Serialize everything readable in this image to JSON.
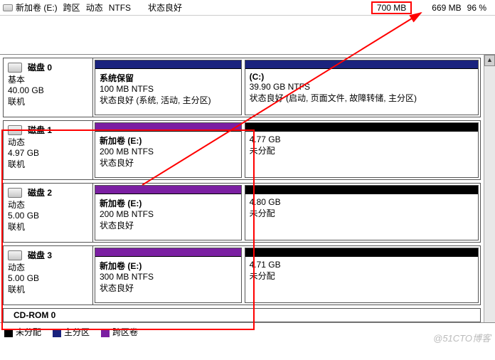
{
  "top": {
    "name": "新加卷 (E:)",
    "layout": "跨区",
    "type": "动态",
    "fs": "NTFS",
    "status": "状态良好",
    "size": "700 MB",
    "free": "669 MB",
    "percent": "96 %"
  },
  "disks": [
    {
      "title": "磁盘 0",
      "kind": "基本",
      "size": "40.00 GB",
      "state": "联机",
      "parts": [
        {
          "bar": "bar-blue",
          "flex": 1,
          "name": "系统保留",
          "line2": "100 MB NTFS",
          "line3": "状态良好 (系统, 活动, 主分区)"
        },
        {
          "bar": "bar-blue",
          "flex": 1.6,
          "name": "(C:)",
          "line2": "39.90 GB NTFS",
          "line3": "状态良好 (启动, 页面文件, 故障转储, 主分区)"
        }
      ]
    },
    {
      "title": "磁盘 1",
      "kind": "动态",
      "size": "4.97 GB",
      "state": "联机",
      "parts": [
        {
          "bar": "bar-purple",
          "flex": 1,
          "name": "新加卷  (E:)",
          "line2": "200 MB NTFS",
          "line3": "状态良好"
        },
        {
          "bar": "bar-black",
          "flex": 1.6,
          "name": "",
          "line2": "4.77 GB",
          "line3": "未分配"
        }
      ]
    },
    {
      "title": "磁盘 2",
      "kind": "动态",
      "size": "5.00 GB",
      "state": "联机",
      "parts": [
        {
          "bar": "bar-purple",
          "flex": 1,
          "name": "新加卷  (E:)",
          "line2": "200 MB NTFS",
          "line3": "状态良好"
        },
        {
          "bar": "bar-black",
          "flex": 1.6,
          "name": "",
          "line2": "4.80 GB",
          "line3": "未分配"
        }
      ]
    },
    {
      "title": "磁盘 3",
      "kind": "动态",
      "size": "5.00 GB",
      "state": "联机",
      "parts": [
        {
          "bar": "bar-purple",
          "flex": 1,
          "name": "新加卷  (E:)",
          "line2": "300 MB NTFS",
          "line3": "状态良好"
        },
        {
          "bar": "bar-black",
          "flex": 1.6,
          "name": "",
          "line2": "4.71 GB",
          "line3": "未分配"
        }
      ]
    }
  ],
  "cdrom": "CD-ROM 0",
  "legend": {
    "unalloc": "未分配",
    "primary": "主分区",
    "spanned": "跨区卷"
  },
  "watermark": "@51CTO博客"
}
